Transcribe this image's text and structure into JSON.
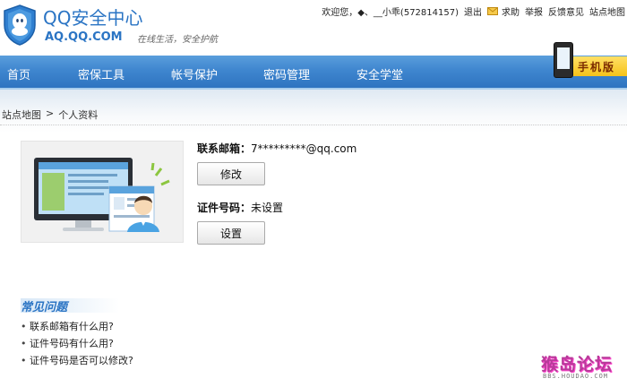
{
  "header": {
    "title": "QQ安全中心",
    "domain": "AQ.QQ.COM",
    "slogan": "在线生活，安全护航"
  },
  "topbar": {
    "greeting": "欢迎您，◆、__小乖(572814157)",
    "logout": "退出",
    "help": "求助",
    "report": "举报",
    "feedback": "反馈意见",
    "sitemap": "站点地图"
  },
  "nav": {
    "items": [
      {
        "label": "首页"
      },
      {
        "label": "密保工具"
      },
      {
        "label": "帐号保护"
      },
      {
        "label": "密码管理"
      },
      {
        "label": "安全学堂"
      }
    ],
    "mobile_label": "手机版"
  },
  "breadcrumb": {
    "items": [
      "站点地图",
      ">",
      "个人资料"
    ]
  },
  "profile": {
    "email_label": "联系邮箱：",
    "email_value": "7*********@qq.com",
    "email_button": "修改",
    "id_label": "证件号码：",
    "id_value": "未设置",
    "id_button": "设置"
  },
  "faq": {
    "title": "常见问题",
    "items": [
      "联系邮箱有什么用?",
      "证件号码有什么用?",
      "证件号码是否可以修改?"
    ]
  },
  "watermark": {
    "text": "猴岛论坛",
    "sub": "BBS.HOUDAO.COM"
  },
  "colors": {
    "brand_blue": "#2a74c4",
    "nav_blue": "#3f86cf",
    "badge_yellow": "#f5c21a"
  }
}
